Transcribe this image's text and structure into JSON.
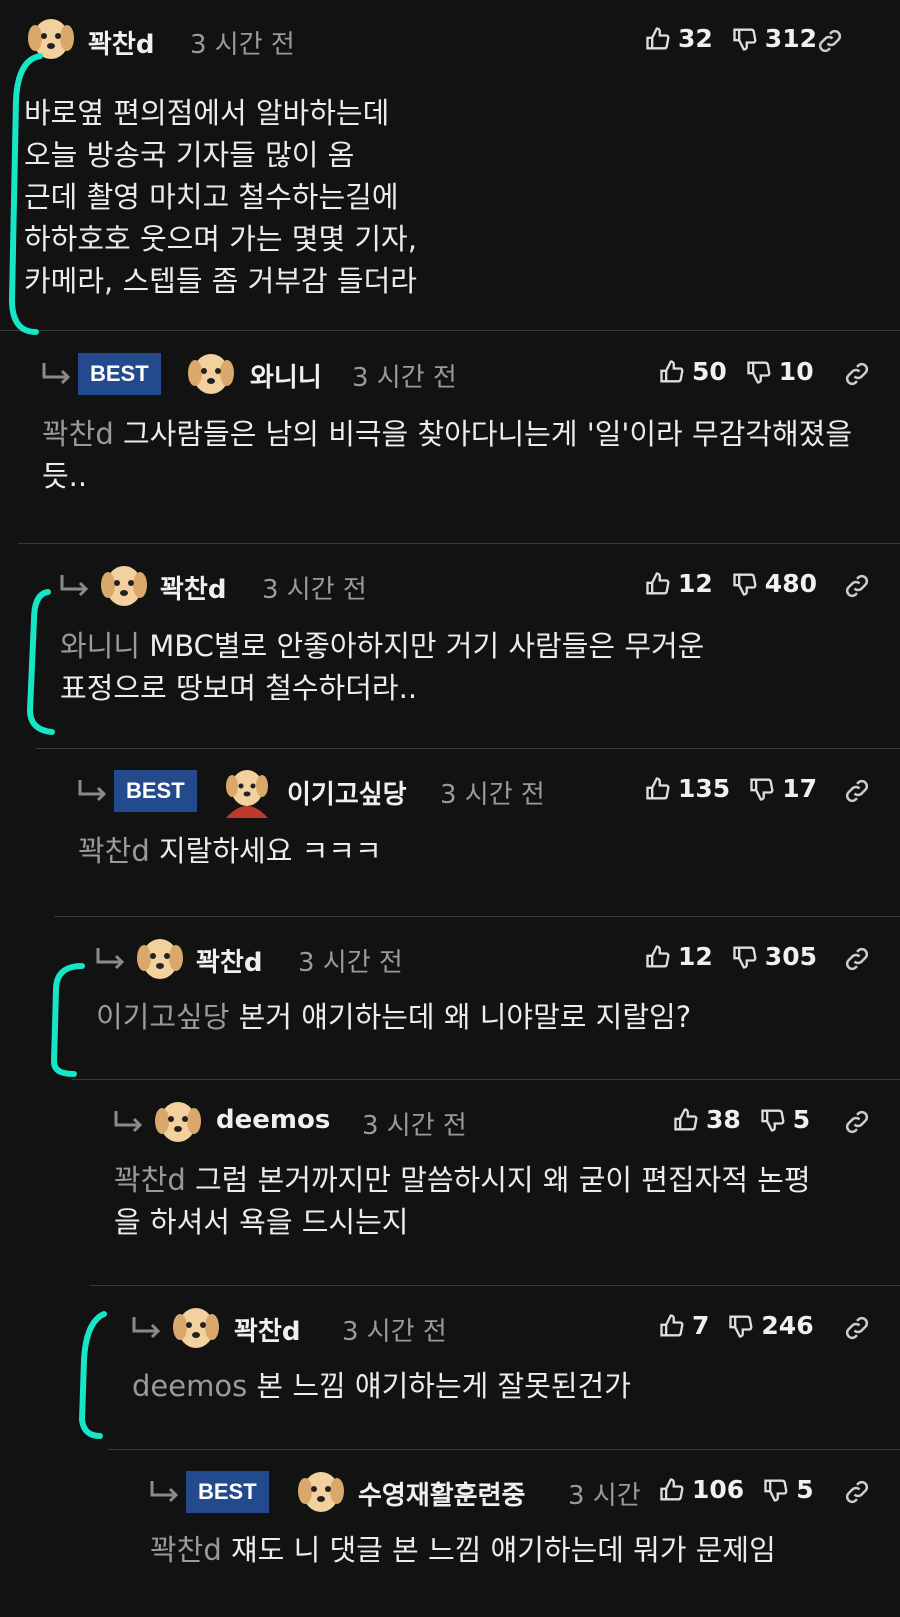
{
  "comments": [
    {
      "author": "꽉찬d",
      "time": "3 시간 전",
      "up": "32",
      "down": "312",
      "best": "",
      "mention": "",
      "text": "바로옆 편의점에서 알바하는데\n오늘 방송국 기자들 많이 옴\n근데 촬영 마치고 철수하는길에\n하하호호 웃으며 가는 몇몇 기자,\n카메라, 스텝들 좀 거부감 들더라"
    },
    {
      "author": "와니니",
      "time": "3 시간 전",
      "up": "50",
      "down": "10",
      "best": "BEST",
      "mention": "꽉찬d",
      "text": " 그사람들은 남의 비극을 찾아다니는게 '일'이라 무감각해졌을듯.."
    },
    {
      "author": "꽉찬d",
      "time": "3 시간 전",
      "up": "12",
      "down": "480",
      "best": "",
      "mention": "와니니",
      "text": " MBC별로 안좋아하지만 거기 사람들은 무거운\n표정으로 땅보며 철수하더라.."
    },
    {
      "author": "이기고싶당",
      "time": "3 시간 전",
      "up": "135",
      "down": "17",
      "best": "BEST",
      "mention": "꽉찬d",
      "text": " 지랄하세요 ㅋㅋㅋ"
    },
    {
      "author": "꽉찬d",
      "time": "3 시간 전",
      "up": "12",
      "down": "305",
      "best": "",
      "mention": "이기고싶당",
      "text": " 본거 얘기하는데 왜 니야말로 지랄임?"
    },
    {
      "author": "deemos",
      "time": "3 시간 전",
      "up": "38",
      "down": "5",
      "best": "",
      "mention": "꽉찬d",
      "text": " 그럼 본거까지만 말씀하시지 왜 굳이 편집자적 논평\n을 하셔서 욕을 드시는지"
    },
    {
      "author": "꽉찬d",
      "time": "3 시간 전",
      "up": "7",
      "down": "246",
      "best": "",
      "mention": "deemos",
      "text": " 본 느낌 얘기하는게 잘못된건가"
    },
    {
      "author": "수영재활훈련중",
      "time": "3 시간",
      "up": "106",
      "down": "5",
      "best": "BEST",
      "mention": "꽉찬d",
      "text": " 쟤도 니 댓글 본 느낌 얘기하는데 뭐가 문제임"
    }
  ],
  "colors": {
    "background": "#121212",
    "best_badge": "#224a8c",
    "annotation": "#17e5c8",
    "mention": "#9a9a9a"
  },
  "icons": {
    "upvote": "thumbs-up-icon",
    "downvote": "thumbs-down-icon",
    "permalink": "link-icon",
    "reply": "reply-arrow-icon",
    "avatar": "puppy-avatar-icon"
  }
}
